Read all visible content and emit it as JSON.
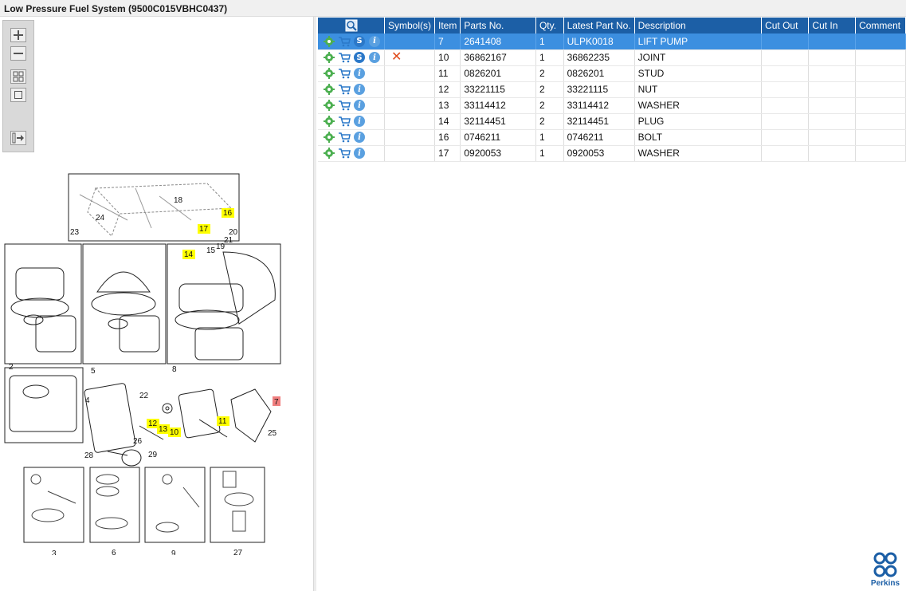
{
  "window": {
    "title": "Low Pressure Fuel System (9500C015VBHC0437)"
  },
  "zoom_tools": [
    {
      "name": "zoom-in-icon"
    },
    {
      "name": "zoom-out-icon"
    },
    {
      "name": "fit-page-icon"
    },
    {
      "name": "actual-size-icon"
    },
    {
      "name": "expand-list-icon"
    }
  ],
  "drawing": {
    "callouts": [
      "18",
      "24",
      "16",
      "23",
      "17",
      "20",
      "21",
      "19",
      "15",
      "14",
      "2",
      "5",
      "8",
      "4",
      "22",
      "7",
      "12",
      "13",
      "10",
      "11",
      "25",
      "26",
      "28",
      "29",
      "3",
      "6",
      "9",
      "27"
    ],
    "highlighted": [
      "16",
      "17",
      "14",
      "12",
      "13",
      "10",
      "11"
    ],
    "selected": "7"
  },
  "table": {
    "headers": {
      "tools": "",
      "symbols": "Symbol(s)",
      "item": "Item",
      "parts_no": "Parts No.",
      "qty": "Qty.",
      "latest_part_no": "Latest Part No.",
      "description": "Description",
      "cut_out": "Cut Out",
      "cut_in": "Cut In",
      "comment": "Comment"
    },
    "rows": [
      {
        "item": "7",
        "parts_no": "2641408",
        "qty": "1",
        "latest": "ULPK0018",
        "description": "LIFT PUMP",
        "cut": false,
        "has_s": true,
        "selected": true
      },
      {
        "item": "10",
        "parts_no": "36862167",
        "qty": "1",
        "latest": "36862235",
        "description": "JOINT",
        "cut": true,
        "has_s": true,
        "selected": false
      },
      {
        "item": "11",
        "parts_no": "0826201",
        "qty": "2",
        "latest": "0826201",
        "description": "STUD",
        "cut": false,
        "has_s": false,
        "selected": false
      },
      {
        "item": "12",
        "parts_no": "33221115",
        "qty": "2",
        "latest": "33221115",
        "description": "NUT",
        "cut": false,
        "has_s": false,
        "selected": false
      },
      {
        "item": "13",
        "parts_no": "33114412",
        "qty": "2",
        "latest": "33114412",
        "description": "WASHER",
        "cut": false,
        "has_s": false,
        "selected": false
      },
      {
        "item": "14",
        "parts_no": "32114451",
        "qty": "2",
        "latest": "32114451",
        "description": "PLUG",
        "cut": false,
        "has_s": false,
        "selected": false
      },
      {
        "item": "16",
        "parts_no": "0746211",
        "qty": "1",
        "latest": "0746211",
        "description": "BOLT",
        "cut": false,
        "has_s": false,
        "selected": false
      },
      {
        "item": "17",
        "parts_no": "0920053",
        "qty": "1",
        "latest": "0920053",
        "description": "WASHER",
        "cut": false,
        "has_s": false,
        "selected": false
      }
    ]
  },
  "row_icons": {
    "add": "gear-icon",
    "cart": "cart-icon",
    "service": "S",
    "info": "i",
    "cut": "✕"
  },
  "logo": {
    "brand": "Perkins"
  },
  "colors": {
    "header": "#1c5fa6",
    "selected_row": "#3c8fe0",
    "highlight": "#ffff00",
    "selected_callout": "#f08080"
  }
}
